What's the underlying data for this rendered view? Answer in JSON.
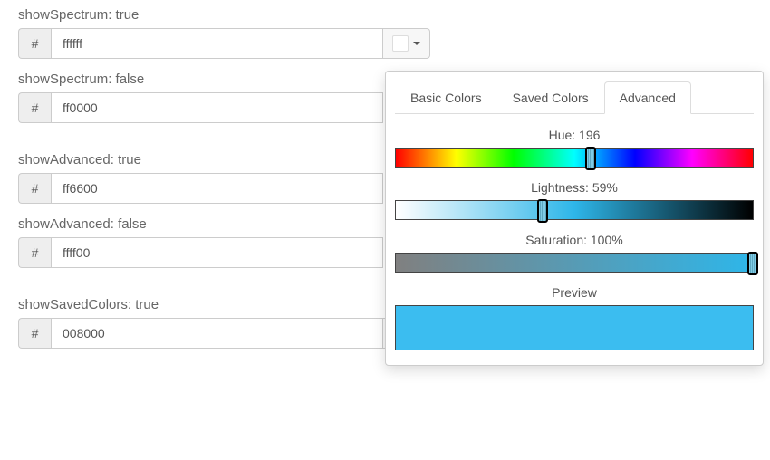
{
  "fields": [
    {
      "label": "showSpectrum: true",
      "value": "ffffff",
      "swatch": "#ffffff"
    },
    {
      "label": "showSpectrum: false",
      "value": "ff0000",
      "swatch": "#ff0000"
    },
    {
      "label": "showAdvanced: true",
      "value": "ff6600",
      "swatch": "#ff6600"
    },
    {
      "label": "showAdvanced: false",
      "value": "ffff00",
      "swatch": "#ffff00"
    },
    {
      "label": "showSavedColors: true",
      "value": "008000",
      "swatch": "#008000"
    }
  ],
  "hash_label": "#",
  "popover": {
    "tabs": {
      "basic": "Basic Colors",
      "saved": "Saved Colors",
      "advanced": "Advanced",
      "active": "advanced"
    },
    "hue": {
      "label": "Hue: 196",
      "value": 196,
      "max": 360
    },
    "lightness": {
      "label": "Lightness: 59%",
      "value": 59,
      "max": 100
    },
    "saturation": {
      "label": "Saturation: 100%",
      "value": 100,
      "max": 100
    },
    "preview_label": "Preview",
    "preview_color": "#3bbdf0"
  },
  "chart_data": {
    "type": "table",
    "title": "Color picker HSL values",
    "series": [
      {
        "name": "Hue",
        "values": [
          196
        ],
        "range": [
          0,
          360
        ]
      },
      {
        "name": "Lightness",
        "values": [
          59
        ],
        "range": [
          0,
          100
        ]
      },
      {
        "name": "Saturation",
        "values": [
          100
        ],
        "range": [
          0,
          100
        ]
      }
    ]
  }
}
